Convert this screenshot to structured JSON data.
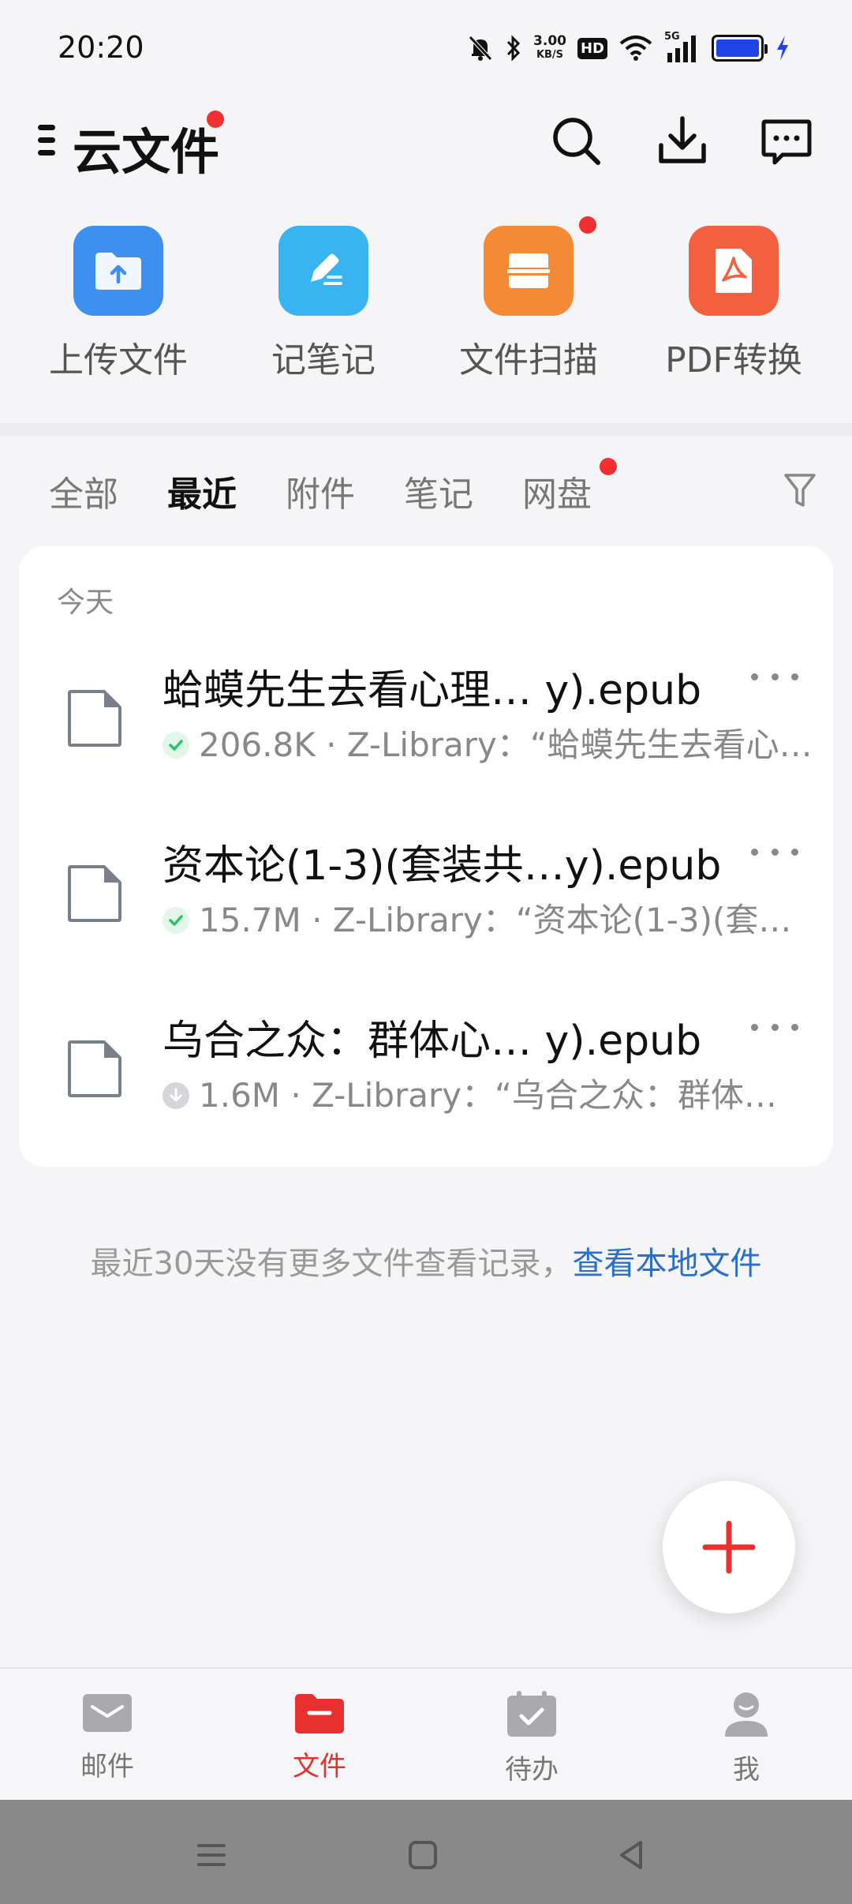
{
  "status_bar": {
    "time": "20:20",
    "net_speed": "3.00",
    "net_unit": "KB/S",
    "hd": "HD",
    "signal_label": "5G"
  },
  "header": {
    "title": "云文件"
  },
  "quick_actions": [
    {
      "label": "上传文件",
      "icon": "upload-folder-icon",
      "color": "#3d8ff0"
    },
    {
      "label": "记笔记",
      "icon": "pen-note-icon",
      "color": "#38b4f0"
    },
    {
      "label": "文件扫描",
      "icon": "scan-icon",
      "color": "#f58a36"
    },
    {
      "label": "PDF转换",
      "icon": "pdf-icon",
      "color": "#f2603f"
    }
  ],
  "tabs": [
    {
      "label": "全部",
      "active": false
    },
    {
      "label": "最近",
      "active": true
    },
    {
      "label": "附件",
      "active": false
    },
    {
      "label": "笔记",
      "active": false
    },
    {
      "label": "网盘",
      "active": false
    }
  ],
  "recent": {
    "section_label": "今天",
    "files": [
      {
        "name": "蛤蟆先生去看心理… y).epub",
        "meta": "206.8K · Z-Library：“蛤蟆先生去看心…",
        "status": "synced"
      },
      {
        "name": "资本论(1-3)(套装共…y).epub",
        "meta": "15.7M · Z-Library：“资本论(1-3)(套…",
        "status": "synced"
      },
      {
        "name": "乌合之众：群体心… y).epub",
        "meta": "1.6M · Z-Library：“乌合之众：群体…",
        "status": "not-downloaded"
      }
    ]
  },
  "footer_note": {
    "text": "最近30天没有更多文件查看记录，",
    "link": "查看本地文件"
  },
  "bottom_nav": [
    {
      "label": "邮件",
      "icon": "mail-icon",
      "active": false
    },
    {
      "label": "文件",
      "icon": "folder-icon",
      "active": true
    },
    {
      "label": "待办",
      "icon": "calendar-check-icon",
      "active": false
    },
    {
      "label": "我",
      "icon": "profile-icon",
      "active": false
    }
  ],
  "colors": {
    "accent_red": "#e8302e",
    "link_blue": "#2a6fc9",
    "synced_green": "#2cc26a"
  }
}
